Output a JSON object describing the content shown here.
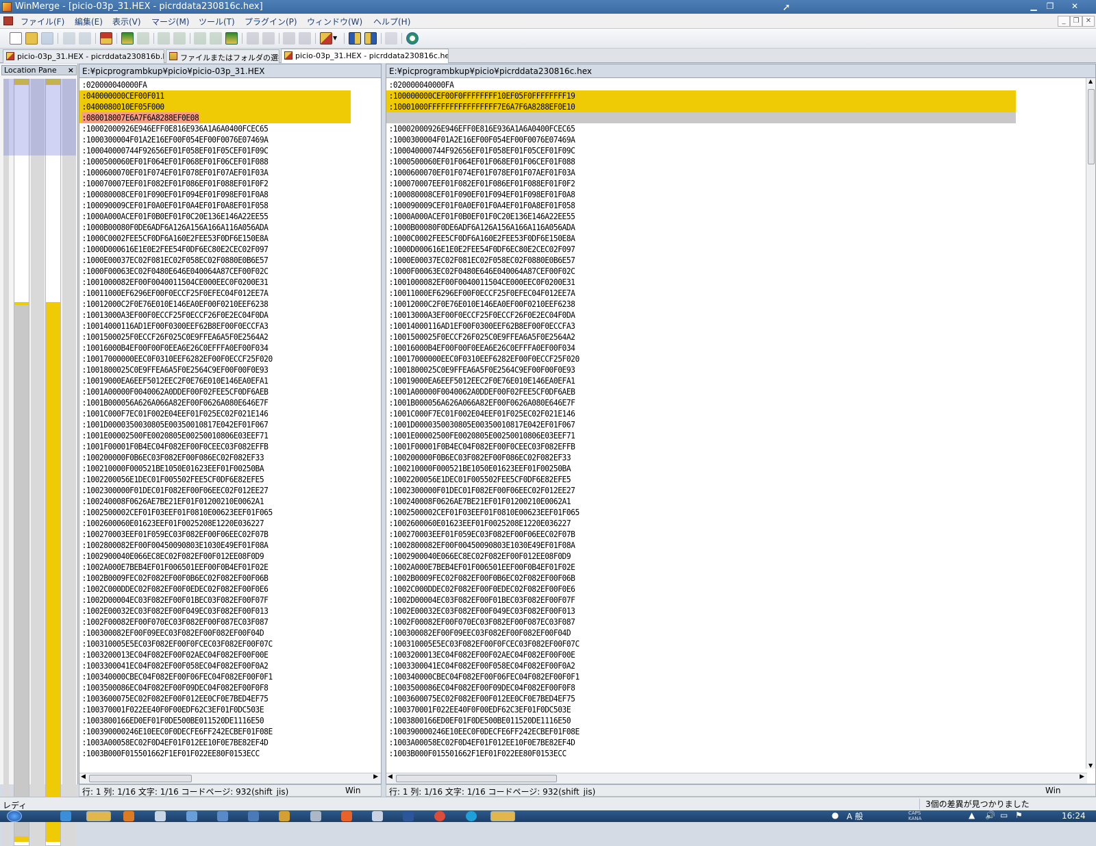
{
  "window": {
    "title": "WinMerge - [picio-03p_31.HEX - picrddata230816c.hex]"
  },
  "menu": [
    "ファイル(F)",
    "編集(E)",
    "表示(V)",
    "マージ(M)",
    "ツール(T)",
    "プラグイン(P)",
    "ウィンドウ(W)",
    "ヘルプ(H)"
  ],
  "tabs": [
    {
      "label": "picio-03p_31.HEX - picrddata230816b.hex"
    },
    {
      "label": "ファイルまたはフォルダの選択..."
    },
    {
      "label": "picio-03p_31.HEX - picrddata230816c.hex"
    }
  ],
  "location_pane": {
    "title": "Location Pane",
    "close": "×"
  },
  "left": {
    "path": "E:¥picprogrambkup¥picio¥picio-03p_31.HEX",
    "lines": [
      ":020000040000FA",
      ":040000000CEF00F011",
      ":0400080010EF05F000",
      ":080018007E6A7F6A8288EF0E08",
      ":10002000926E946EFF0E816E936A1A6A0400FCEC65",
      ":1000300004F01A2E16EF00F054EF00F0076E07469A",
      ":100040000744F92656EF01F058EF01F05CEF01F09C",
      ":1000500060EF01F064EF01F068EF01F06CEF01F088",
      ":1000600070EF01F074EF01F078EF01F07AEF01F03A",
      ":100070007EEF01F082EF01F086EF01F088EF01F0F2",
      ":100080008CEF01F090EF01F094EF01F098EF01F0A8",
      ":100090009CEF01F0A0EF01F0A4EF01F0A8EF01F058",
      ":1000A000ACEF01F0B0EF01F0C20E136E146A22EE55",
      ":1000B00080F0DE6ADF6A126A156A166A116A056ADA",
      ":1000C0002FEE5CF0DF6A160E2FEE53F0DF6E150E8A",
      ":1000D000616E1E0E2FEE54F0DF6EC80E2CEC02F097",
      ":1000E00037EC02F081EC02F058EC02F0880E0B6E57",
      ":1000F00063EC02F0480E646E040064A87CEF00F02C",
      ":1001000082EF00F0040011504CE000EEC0F0200E31",
      ":10011000EF6296EF00F0ECCF25F0EFEC04F012EE7A",
      ":10012000C2F0E76E010E146EA0EF00F0210EEF6238",
      ":10013000A3EF00F0ECCF25F0ECCF26F0E2EC04F0DA",
      ":10014000116AD1EF00F0300EEF62B8EF00F0ECCFA3",
      ":1001500025F0ECCF26F025C0E9FFEA6A5F0E2564A2",
      ":10016000B4EF00F00F0EEA6E26C0EFFFA0EF00F034",
      ":10017000000EEC0F0310EEF6282EF00F0ECCF25F020",
      ":1001800025C0E9FFEA6A5F0E2564C9EF00F00F0E93",
      ":10019000EA6EEF5012EEC2F0E76E010E146EA0EFA1",
      ":1001A00000F0040062A0DDEF00F02FEE5CF0DF6AEB",
      ":1001B000056A626A066A82EF00F0626A080E646E7F",
      ":1001C000F7EC01F002E04EEF01F025EC02F021E146",
      ":1001D0000350030805E00350010817E042EF01F067",
      ":1001E00002500FE0020805E00250010806E03EEF71",
      ":1001F00001F0B4EC04F082EF00F0CEEC03F082EFFB",
      ":100200000F0B6EC03F082EF00F086EC02F082EF33",
      ":100210000F000521BE1050E01623EEF01F00250BA",
      ":1002200056E1DEC01F005502FEE5CF0DF6E82EFE5",
      ":1002300000F01DEC01F082EF00F06EEC02F012EE27",
      ":100240008F0626AE7BE21EF01F01200210E0062A1",
      ":1002500002CEF01F03EEF01F0810E00623EEF01F065",
      ":1002600060E01623EEF01F0025208E1220E036227",
      ":100270003EEF01F059EC03F082EF00F06EEC02F07B",
      ":1002800082EF00F00450090803E1030E49EF01F08A",
      ":1002900040E066EC8EC02F082EF00F012EE08F0D9",
      ":1002A000E7BEB4EF01F006501EEF00F0B4EF01F02E",
      ":1002B0009FEC02F082EF00F0B6EC02F082EF00F06B",
      ":1002C000DDEC02F082EF00F0EDEC02F082EF00F0E6",
      ":1002D00004EC03F082EF00F01BEC03F082EF00F07F",
      ":1002E00032EC03F082EF00F049EC03F082EF00F013",
      ":1002F00082EF00F070EC03F082EF00F087EC03F087",
      ":100300082EF00F09EEC03F082EF00F082EF00F04D",
      ":100310005E5EC03F082EF00F0FCEC03F082EF00F07C",
      ":1003200013EC04F082EF00F02AEC04F082EF00F00E",
      ":1003300041EC04F082EF00F058EC04F082EF00F0A2",
      ":100340000CBEC04F082EF00F06FEC04F082EF00F0F1",
      ":1003500086EC04F082EF00F09DEC04F082EF00F0F8",
      ":1003600075EC02F082EF00F012EE0CF0E7BED4EF75",
      ":100370001F022EE40F0F00EDF62C3EF01F0DC503E",
      ":1003800166ED0EF01F0DE500BE011520DE1116E50",
      ":100390000246E10EEC0F0DECFE6FF242ECBEF01F08E",
      ":1003A00058EC02F0D4EF01F012EE10F0E7BE82EF4D",
      ":1003B000F015501662F1EF01F022EE80F0153ECC"
    ]
  },
  "right": {
    "path": "E:¥picprogrambkup¥picio¥picrddata230816c.hex",
    "lines": [
      ":020000040000FA",
      ":100000000CEF00F0FFFFFFFF10EF05F0FFFFFFFF19",
      ":10001000FFFFFFFFFFFFFFFF7E6A7F6A8288EF0E10",
      "",
      ":10002000926E946EFF0E816E936A1A6A0400FCEC65",
      ":1000300004F01A2E16EF00F054EF00F0076E07469A",
      ":100040000744F92656EF01F058EF01F05CEF01F09C",
      ":1000500060EF01F064EF01F068EF01F06CEF01F088",
      ":1000600070EF01F074EF01F078EF01F07AEF01F03A",
      ":100070007EEF01F082EF01F086EF01F088EF01F0F2",
      ":100080008CEF01F090EF01F094EF01F098EF01F0A8",
      ":100090009CEF01F0A0EF01F0A4EF01F0A8EF01F058",
      ":1000A000ACEF01F0B0EF01F0C20E136E146A22EE55",
      ":1000B00080F0DE6ADF6A126A156A166A116A056ADA",
      ":1000C0002FEE5CF0DF6A160E2FEE53F0DF6E150E8A",
      ":1000D000616E1E0E2FEE54F0DF6EC80E2CEC02F097",
      ":1000E00037EC02F081EC02F058EC02F0880E0B6E57",
      ":1000F00063EC02F0480E646E040064A87CEF00F02C",
      ":1001000082EF00F0040011504CE000EEC0F0200E31",
      ":10011000EF6296EF00F0ECCF25F0EFEC04F012EE7A",
      ":10012000C2F0E76E010E146EA0EF00F0210EEF6238",
      ":10013000A3EF00F0ECCF25F0ECCF26F0E2EC04F0DA",
      ":10014000116AD1EF00F0300EEF62B8EF00F0ECCFA3",
      ":1001500025F0ECCF26F025C0E9FFEA6A5F0E2564A2",
      ":10016000B4EF00F00F0EEA6E26C0EFFFA0EF00F034",
      ":10017000000EEC0F0310EEF6282EF00F0ECCF25F020",
      ":1001800025C0E9FFEA6A5F0E2564C9EF00F00F0E93",
      ":10019000EA6EEF5012EEC2F0E76E010E146EA0EFA1",
      ":1001A00000F0040062A0DDEF00F02FEE5CF0DF6AEB",
      ":1001B000056A626A066A82EF00F0626A080E646E7F",
      ":1001C000F7EC01F002E04EEF01F025EC02F021E146",
      ":1001D0000350030805E00350010817E042EF01F067",
      ":1001E00002500FE0020805E00250010806E03EEF71",
      ":1001F00001F0B4EC04F082EF00F0CEEC03F082EFFB",
      ":100200000F0B6EC03F082EF00F086EC02F082EF33",
      ":100210000F000521BE1050E01623EEF01F00250BA",
      ":1002200056E1DEC01F005502FEE5CF0DF6E82EFE5",
      ":1002300000F01DEC01F082EF00F06EEC02F012EE27",
      ":100240008F0626AE7BE21EF01F01200210E0062A1",
      ":1002500002CEF01F03EEF01F0810E00623EEF01F065",
      ":1002600060E01623EEF01F0025208E1220E036227",
      ":100270003EEF01F059EC03F082EF00F06EEC02F07B",
      ":1002800082EF00F00450090803E1030E49EF01F08A",
      ":1002900040E066EC8EC02F082EF00F012EE08F0D9",
      ":1002A000E7BEB4EF01F006501EEF00F0B4EF01F02E",
      ":1002B0009FEC02F082EF00F0B6EC02F082EF00F06B",
      ":1002C000DDEC02F082EF00F0EDEC02F082EF00F0E6",
      ":1002D00004EC03F082EF00F01BEC03F082EF00F07F",
      ":1002E00032EC03F082EF00F049EC03F082EF00F013",
      ":1002F00082EF00F070EC03F082EF00F087EC03F087",
      ":100300082EF00F09EEC03F082EF00F082EF00F04D",
      ":100310005E5EC03F082EF00F0FCEC03F082EF00F07C",
      ":1003200013EC04F082EF00F02AEC04F082EF00F00E",
      ":1003300041EC04F082EF00F058EC04F082EF00F0A2",
      ":100340000CBEC04F082EF00F06FEC04F082EF00F0F1",
      ":1003500086EC04F082EF00F09DEC04F082EF00F0F8",
      ":1003600075EC02F082EF00F012EE0CF0E7BED4EF75",
      ":100370001F022EE40F0F00EDF62C3EF01F0DC503E",
      ":1003800166ED0EF01F0DE500BE011520DE1116E50",
      ":100390000246E10EEC0F0DECFE6FF242ECBEF01F08E",
      ":1003A00058EC02F0D4EF01F012EE10F0E7BE82EF4D",
      ":1003B000F015501662F1EF01F022EE80F0153ECC"
    ]
  },
  "pane_status": {
    "position": "行: 1  列: 1/16  文字: 1/16  コードページ: 932(shift_jis)",
    "eol": "Win"
  },
  "status": {
    "left": "レディ",
    "right": "3個の差異が見つかりました"
  },
  "tray": {
    "ime": "A 般",
    "caps": "CAPS",
    "kana": "KANA",
    "time": "16:24"
  }
}
